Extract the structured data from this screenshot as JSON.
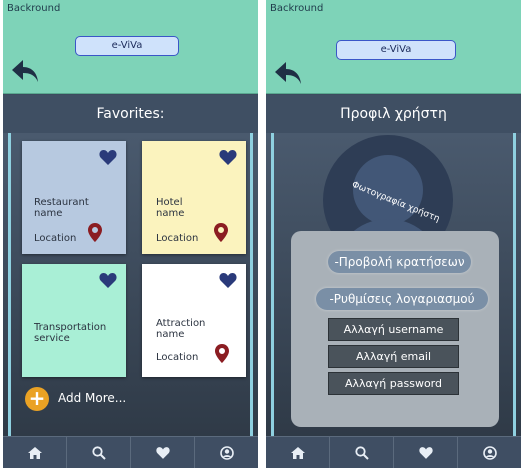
{
  "left_screen": {
    "background_label": "Backround",
    "app_name": "e-ViVa",
    "title": "Favorites:",
    "cards": [
      {
        "name": "Restaurant name",
        "location": "Location",
        "color": "#b7c9e0"
      },
      {
        "name": "Hotel name",
        "location": "Location",
        "color": "#fbf3be"
      },
      {
        "name": "Transportation service",
        "location": "",
        "color": "#a9efd6"
      },
      {
        "name": "Attraction name",
        "location": "Location",
        "color": "#ffffff"
      }
    ],
    "add_more": "Add More..."
  },
  "right_screen": {
    "background_label": "Backround",
    "app_name": "e-ViVa",
    "title": "Προφιλ χρήστη",
    "photo_label": "Φωτογραφία χρήστη",
    "view_bookings": "-Προβολή κρατήσεων",
    "account_settings": "-Ρυθμίσεις λογαριασμού",
    "change_username": "Αλλαγή username",
    "change_email": "Αλλαγή email",
    "change_password": "Αλλαγή password"
  },
  "nav_icons": [
    "home-icon",
    "search-icon",
    "heart-icon",
    "user-icon"
  ],
  "colors": {
    "topbar": "#7ed3b8",
    "heart": "#2a3a7a",
    "pin": "#8b1d22",
    "add_button": "#eaa224",
    "dark_bg": "#3c4b5e"
  }
}
